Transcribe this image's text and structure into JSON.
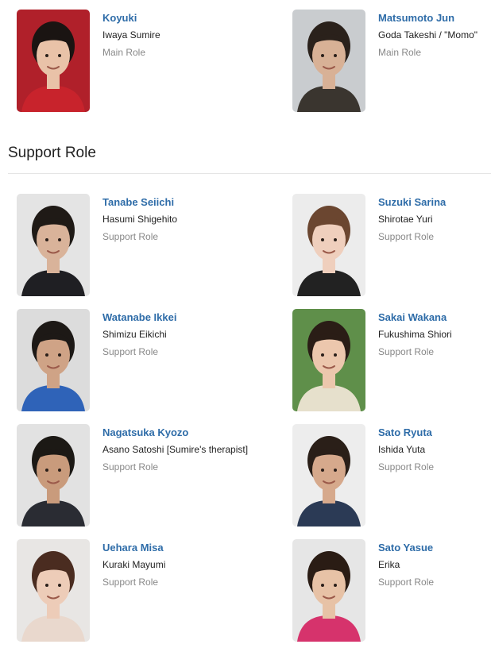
{
  "main_cast": [
    {
      "name": "Koyuki",
      "character": "Iwaya Sumire",
      "role": "Main Role",
      "bg": "#b0202a",
      "hair": "#1a1412",
      "skin": "#e9c2a8",
      "cloth": "#c8232c"
    },
    {
      "name": "Matsumoto Jun",
      "character": "Goda Takeshi / \"Momo\"",
      "role": "Main Role",
      "bg": "#c9cccf",
      "hair": "#2a211b",
      "skin": "#d8b196",
      "cloth": "#3a352f"
    }
  ],
  "support_section": {
    "title": "Support Role"
  },
  "support_cast": [
    {
      "name": "Tanabe Seiichi",
      "character": "Hasumi Shigehito",
      "role": "Support Role",
      "bg": "#e4e4e4",
      "hair": "#1f1a16",
      "skin": "#d9b39a",
      "cloth": "#1f1f23"
    },
    {
      "name": "Suzuki Sarina",
      "character": "Shirotae Yuri",
      "role": "Support Role",
      "bg": "#ececec",
      "hair": "#6b4630",
      "skin": "#efcfbd",
      "cloth": "#222222"
    },
    {
      "name": "Watanabe Ikkei",
      "character": "Shimizu Eikichi",
      "role": "Support Role",
      "bg": "#dcdcdc",
      "hair": "#1d1916",
      "skin": "#cfa386",
      "cloth": "#2f63b8"
    },
    {
      "name": "Sakai Wakana",
      "character": "Fukushima Shiori",
      "role": "Support Role",
      "bg": "#5f8f4a",
      "hair": "#2a1d16",
      "skin": "#ecc7ad",
      "cloth": "#e6e0cc"
    },
    {
      "name": "Nagatsuka Kyozo",
      "character": "Asano Satoshi [Sumire's therapist]",
      "role": "Support Role",
      "bg": "#e2e2e2",
      "hair": "#1c1915",
      "skin": "#c99b7c",
      "cloth": "#2a2c33"
    },
    {
      "name": "Sato Ryuta",
      "character": "Ishida Yuta",
      "role": "Support Role",
      "bg": "#ededed",
      "hair": "#2a1f18",
      "skin": "#d6a98c",
      "cloth": "#2b3a55"
    },
    {
      "name": "Uehara Misa",
      "character": "Kuraki Mayumi",
      "role": "Support Role",
      "bg": "#e8e6e4",
      "hair": "#4a2c20",
      "skin": "#edccb8",
      "cloth": "#e9d8cd"
    },
    {
      "name": "Sato Yasue",
      "character": "Erika",
      "role": "Support Role",
      "bg": "#e6e6e6",
      "hair": "#2a1c14",
      "skin": "#e7c2a6",
      "cloth": "#d6336c"
    }
  ]
}
